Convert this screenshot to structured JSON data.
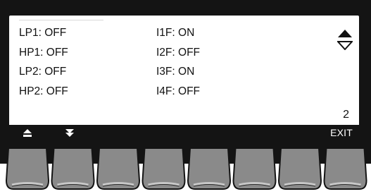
{
  "screen": {
    "rows": [
      {
        "left": "LP1: OFF",
        "right": "I1F: ON"
      },
      {
        "left": "HP1: OFF",
        "right": "I2F: OFF"
      },
      {
        "left": "LP2: OFF",
        "right": "I3F: ON"
      },
      {
        "left": "HP2: OFF",
        "right": "I4F: OFF"
      }
    ],
    "page_number": "2",
    "scroll_icon": "up-down-scroll-icon"
  },
  "softkeys": {
    "key1_icon": "page-up-icon",
    "key2_icon": "page-down-icon",
    "exit_label": "EXIT"
  },
  "hardware_keys": {
    "count": 8
  },
  "colors": {
    "bezel": "#141414",
    "screen": "#ffffff",
    "key_face": "#8a8a8a",
    "key_highlight": "#c8c8c8",
    "text": "#111111"
  }
}
